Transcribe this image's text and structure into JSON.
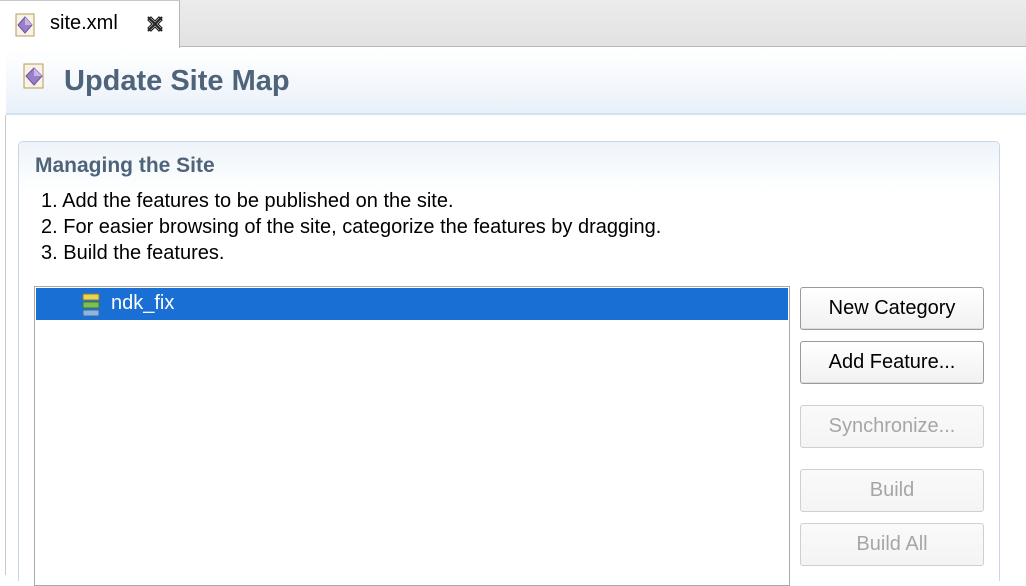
{
  "tab": {
    "label": "site.xml",
    "icon": "xml-file-icon"
  },
  "header": {
    "title": "Update Site Map",
    "icon": "update-site-icon"
  },
  "section": {
    "title": "Managing the Site",
    "steps": [
      "1. Add the features to be published on the site.",
      "2. For easier browsing of the site, categorize the features by dragging.",
      "3. Build the features."
    ]
  },
  "tree": {
    "items": [
      {
        "label": "ndk_fix",
        "icon": "feature-icon",
        "selected": true
      }
    ]
  },
  "buttons": {
    "new_category": "New Category",
    "add_feature": "Add Feature...",
    "synchronize": "Synchronize...",
    "build": "Build",
    "build_all": "Build All"
  },
  "colors": {
    "selection": "#1a6fd4",
    "title_text": "#4f637a",
    "disabled_text": "#a6a6a6"
  }
}
